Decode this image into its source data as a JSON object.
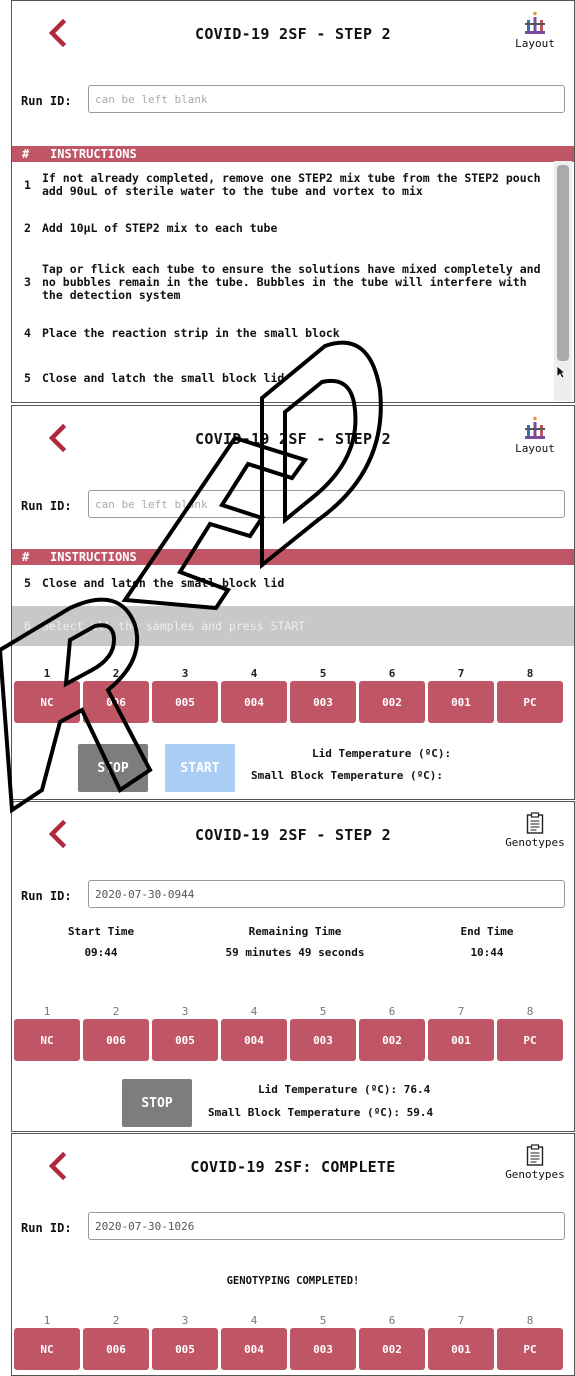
{
  "icons": {
    "back": "chevron-left-icon",
    "layout": "test-tubes-icon",
    "genotypes": "clipboard-icon",
    "cursor": "mouse-pointer-icon"
  },
  "colors": {
    "accent": "#c05566",
    "stop": "#7d7d7d",
    "start_disabled": "#a9cdf4"
  },
  "panel1": {
    "title": "COVID-19 2SF - STEP 2",
    "topright_label": "Layout",
    "run_id_label": "Run ID:",
    "run_id_placeholder": "can be left blank",
    "instructions_header_hash": "#",
    "instructions_header_label": "INSTRUCTIONS",
    "instructions": [
      {
        "num": "1",
        "text": "If not already completed, remove one STEP2 mix tube from the STEP2 pouch add 90uL of sterile water to the tube and vortex to mix"
      },
      {
        "num": "2",
        "text": "Add 10µL of STEP2 mix to each tube"
      },
      {
        "num": "3",
        "text": "Tap or flick each tube to ensure the solutions have mixed completely and no bubbles remain in the tube. Bubbles in the tube will interfere with the detection system"
      },
      {
        "num": "4",
        "text": "Place the reaction strip in the small block"
      },
      {
        "num": "5",
        "text": "Close and latch the small block lid"
      }
    ]
  },
  "panel2": {
    "title": "COVID-19 2SF - STEP 2",
    "topright_label": "Layout",
    "run_id_label": "Run ID:",
    "run_id_placeholder": "can be left blank",
    "instructions_header_hash": "#",
    "instructions_header_label": "INSTRUCTIONS",
    "instructions": [
      {
        "num": "5",
        "text": "Close and latch the small block lid"
      },
      {
        "num": "6",
        "text": "Select all the samples and press START"
      }
    ],
    "tube_numbers": [
      "1",
      "2",
      "3",
      "4",
      "5",
      "6",
      "7",
      "8"
    ],
    "tubes": [
      "NC",
      "006",
      "005",
      "004",
      "003",
      "002",
      "001",
      "PC"
    ],
    "stop_label": "STOP",
    "start_label": "START",
    "lid_temp_label": "Lid Temperature (ºC):",
    "block_temp_label": "Small Block Temperature (ºC):"
  },
  "panel3": {
    "title": "COVID-19 2SF - STEP 2",
    "topright_label": "Genotypes",
    "run_id_label": "Run ID:",
    "run_id_value": "2020-07-30-0944",
    "start_time_label": "Start Time",
    "start_time_value": "09:44",
    "remaining_time_label": "Remaining Time",
    "remaining_time_value": "59 minutes 49 seconds",
    "end_time_label": "End Time",
    "end_time_value": "10:44",
    "tube_numbers": [
      "1",
      "2",
      "3",
      "4",
      "5",
      "6",
      "7",
      "8"
    ],
    "tubes": [
      "NC",
      "006",
      "005",
      "004",
      "003",
      "002",
      "001",
      "PC"
    ],
    "stop_label": "STOP",
    "lid_temp_label": "Lid Temperature (ºC): 76.4",
    "block_temp_label": "Small Block Temperature (ºC): 59.4"
  },
  "panel4": {
    "title": "COVID-19 2SF: COMPLETE",
    "topright_label": "Genotypes",
    "run_id_label": "Run ID:",
    "run_id_value": "2020-07-30-1026",
    "complete_message": "GENOTYPING COMPLETED!",
    "tube_numbers": [
      "1",
      "2",
      "3",
      "4",
      "5",
      "6",
      "7",
      "8"
    ],
    "tubes": [
      "NC",
      "006",
      "005",
      "004",
      "003",
      "002",
      "001",
      "PC"
    ]
  }
}
